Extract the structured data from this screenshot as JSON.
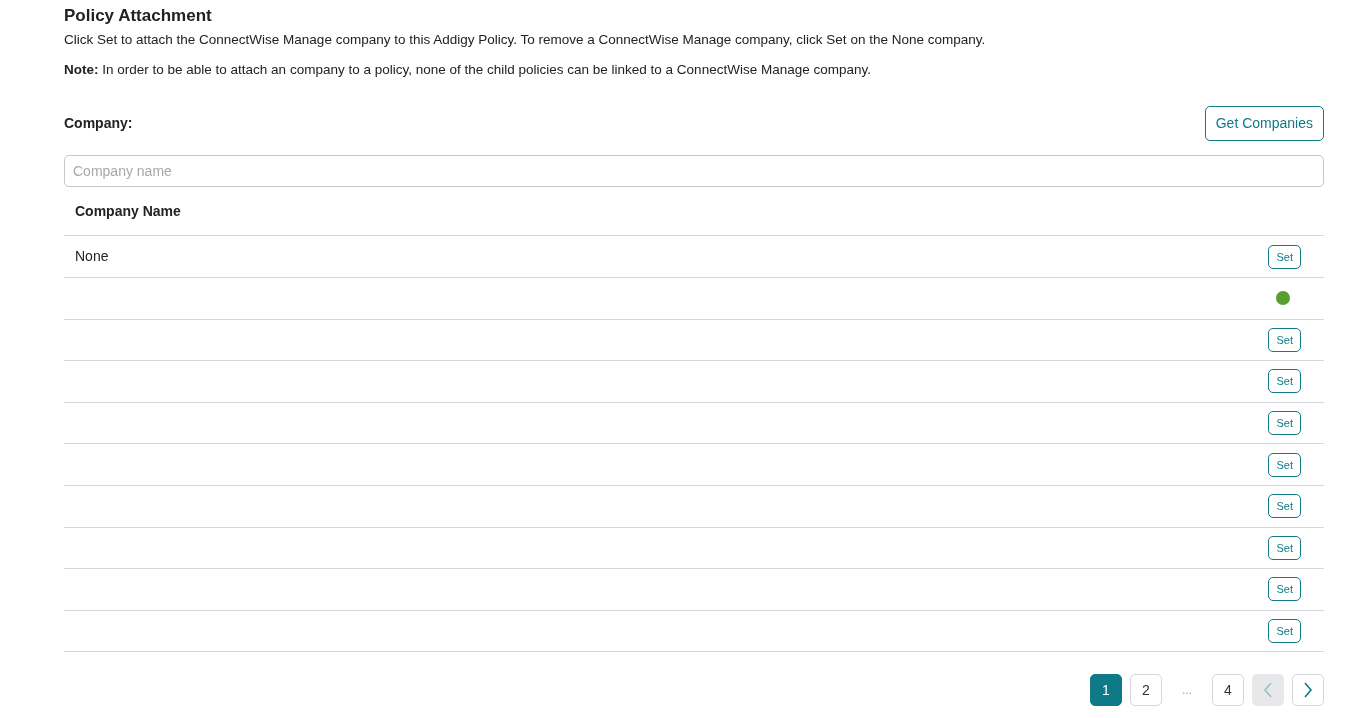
{
  "title": "Policy Attachment",
  "description": "Click Set to attach the ConnectWise Manage company to this Addigy Policy. To remove a ConnectWise Manage company, click Set on the None company.",
  "note": "**Note:** In order to be able to attach an company to a policy, none of the child policies can be linked to a ConnectWise Manage company.",
  "company_label": "Company:",
  "get_companies_button": "Get Companies",
  "search": {
    "placeholder": "Company name"
  },
  "table": {
    "columns": [
      "Company Name"
    ],
    "rows": [
      {
        "name": "None",
        "selected": false,
        "action": "Set"
      },
      {
        "selected": true
      },
      {
        "selected": false,
        "action": "Set"
      },
      {
        "selected": false,
        "action": "Set"
      },
      {
        "selected": false,
        "action": "Set"
      },
      {
        "selected": false,
        "action": "Set"
      },
      {
        "selected": false,
        "action": "Set"
      },
      {
        "selected": false,
        "action": "Set"
      },
      {
        "selected": false,
        "action": "Set"
      },
      {
        "selected": false,
        "action": "Set"
      }
    ]
  },
  "pagination": {
    "pages": [
      {
        "kind": "page",
        "label": "1",
        "selected": true
      },
      {
        "kind": "page",
        "label": "2",
        "selected": false
      },
      {
        "kind": "ellipsis",
        "label": "..."
      },
      {
        "kind": "page",
        "label": "4",
        "selected": false
      }
    ],
    "prev": {
      "disabled": true
    },
    "next": {
      "disabled": false
    }
  }
}
